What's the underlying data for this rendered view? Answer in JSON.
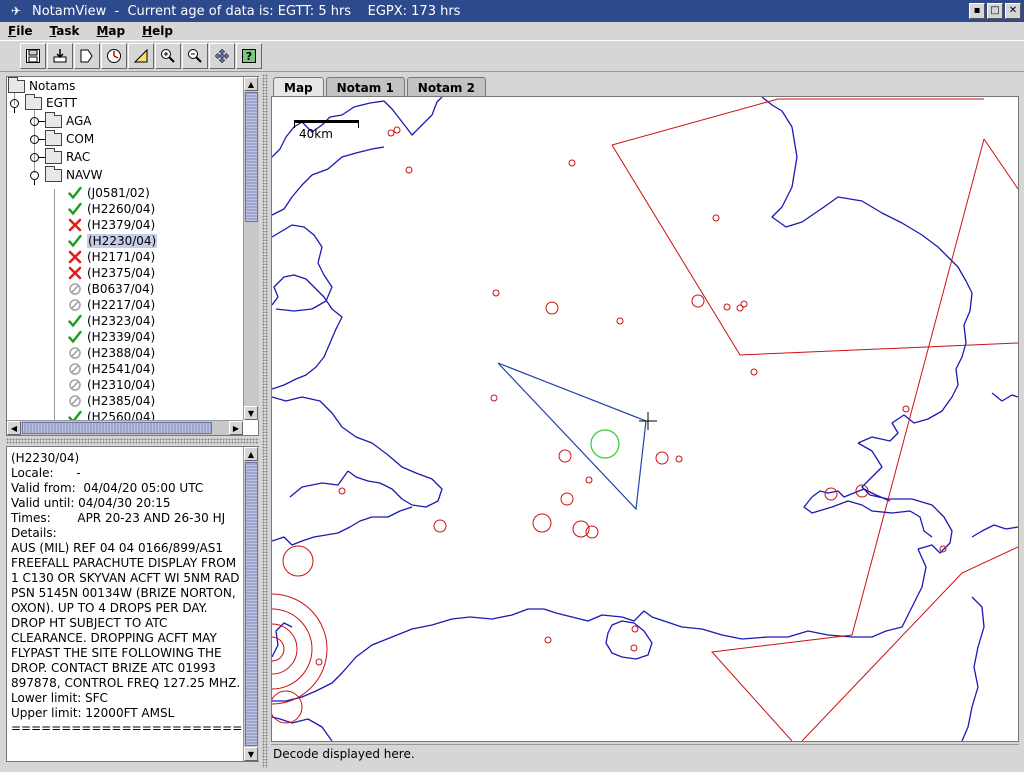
{
  "window": {
    "title": "NotamView  -  Current age of data is: EGTT: 5 hrs    EGPX: 173 hrs",
    "icon_label": "✈",
    "controls": [
      "▪",
      "□",
      "✕"
    ]
  },
  "menu": {
    "items": [
      {
        "name": "file",
        "label": "File",
        "mnemonic": "F",
        "rest": "ile"
      },
      {
        "name": "task",
        "label": "Task",
        "mnemonic": "T",
        "rest": "ask"
      },
      {
        "name": "map",
        "label": "Map",
        "mnemonic": "M",
        "rest": "ap"
      },
      {
        "name": "help",
        "label": "Help",
        "mnemonic": "H",
        "rest": "elp"
      }
    ]
  },
  "toolbar": {
    "buttons": [
      {
        "name": "save-icon"
      },
      {
        "name": "import-icon"
      },
      {
        "name": "export-icon"
      },
      {
        "name": "clock-icon"
      },
      {
        "name": "ruler-icon"
      },
      {
        "name": "zoom-in-icon"
      },
      {
        "name": "zoom-out-icon"
      },
      {
        "name": "pan-icon"
      },
      {
        "name": "help-icon"
      }
    ]
  },
  "tree": {
    "root": "Notams",
    "region": "EGTT",
    "categories": [
      "AGA",
      "COM",
      "RAC",
      "NAVW"
    ],
    "items": [
      {
        "id": "(J0581/02)",
        "status": "ok"
      },
      {
        "id": "(H2260/04)",
        "status": "ok"
      },
      {
        "id": "(H2379/04)",
        "status": "rejected"
      },
      {
        "id": "(H2230/04)",
        "status": "ok",
        "selected": true
      },
      {
        "id": "(H2171/04)",
        "status": "rejected"
      },
      {
        "id": "(H2375/04)",
        "status": "rejected"
      },
      {
        "id": "(B0637/04)",
        "status": "disabled"
      },
      {
        "id": "(H2217/04)",
        "status": "disabled"
      },
      {
        "id": "(H2323/04)",
        "status": "ok"
      },
      {
        "id": "(H2339/04)",
        "status": "ok"
      },
      {
        "id": "(H2388/04)",
        "status": "disabled"
      },
      {
        "id": "(H2541/04)",
        "status": "disabled"
      },
      {
        "id": "(H2310/04)",
        "status": "disabled"
      },
      {
        "id": "(H2385/04)",
        "status": "disabled"
      },
      {
        "id": "(H2560/04)",
        "status": "ok"
      }
    ]
  },
  "details": {
    "lines": [
      "(H2230/04)",
      "Locale:      -",
      "Valid from:  04/04/20 05:00 UTC",
      "Valid until: 04/04/30 20:15",
      "Times:       APR 20-23 AND 26-30 HJ",
      "Details:",
      "AUS (MIL) REF 04 04 0166/899/AS1",
      "FREEFALL PARACHUTE DISPLAY FROM",
      "1 C130 OR SKYVAN ACFT WI 5NM RAD",
      "PSN 5145N 00134W (BRIZE NORTON,",
      "OXON). UP TO 4 DROPS PER DAY.",
      "DROP HT SUBJECT TO ATC",
      "CLEARANCE. DROPPING ACFT MAY",
      "FLYPAST THE SITE FOLLOWING THE",
      "DROP. CONTACT BRIZE ATC 01993",
      "897878, CONTROL FREQ 127.25 MHZ.",
      "Lower limit: SFC",
      "Upper limit: 12000FT AMSL",
      "========================="
    ]
  },
  "tabs": [
    {
      "name": "tab-map",
      "label": "Map",
      "active": true
    },
    {
      "name": "tab-notam-1",
      "label": "Notam 1",
      "active": false
    },
    {
      "name": "tab-notam-2",
      "label": "Notam 2",
      "active": false
    }
  ],
  "map": {
    "scale_label": "40km",
    "colors": {
      "coast": "#1a1ab4",
      "notam_area": "#cc1111",
      "selected_area": "#2244aa",
      "active_circle": "#33cc33"
    }
  },
  "status_bar": {
    "text": "Decode displayed here."
  },
  "colors": {
    "titlebar": "#2d4a8c",
    "selection": "#c9cbeb",
    "ok": "#18a018",
    "rejected": "#e02020",
    "disabled": "#a0a0a0"
  }
}
